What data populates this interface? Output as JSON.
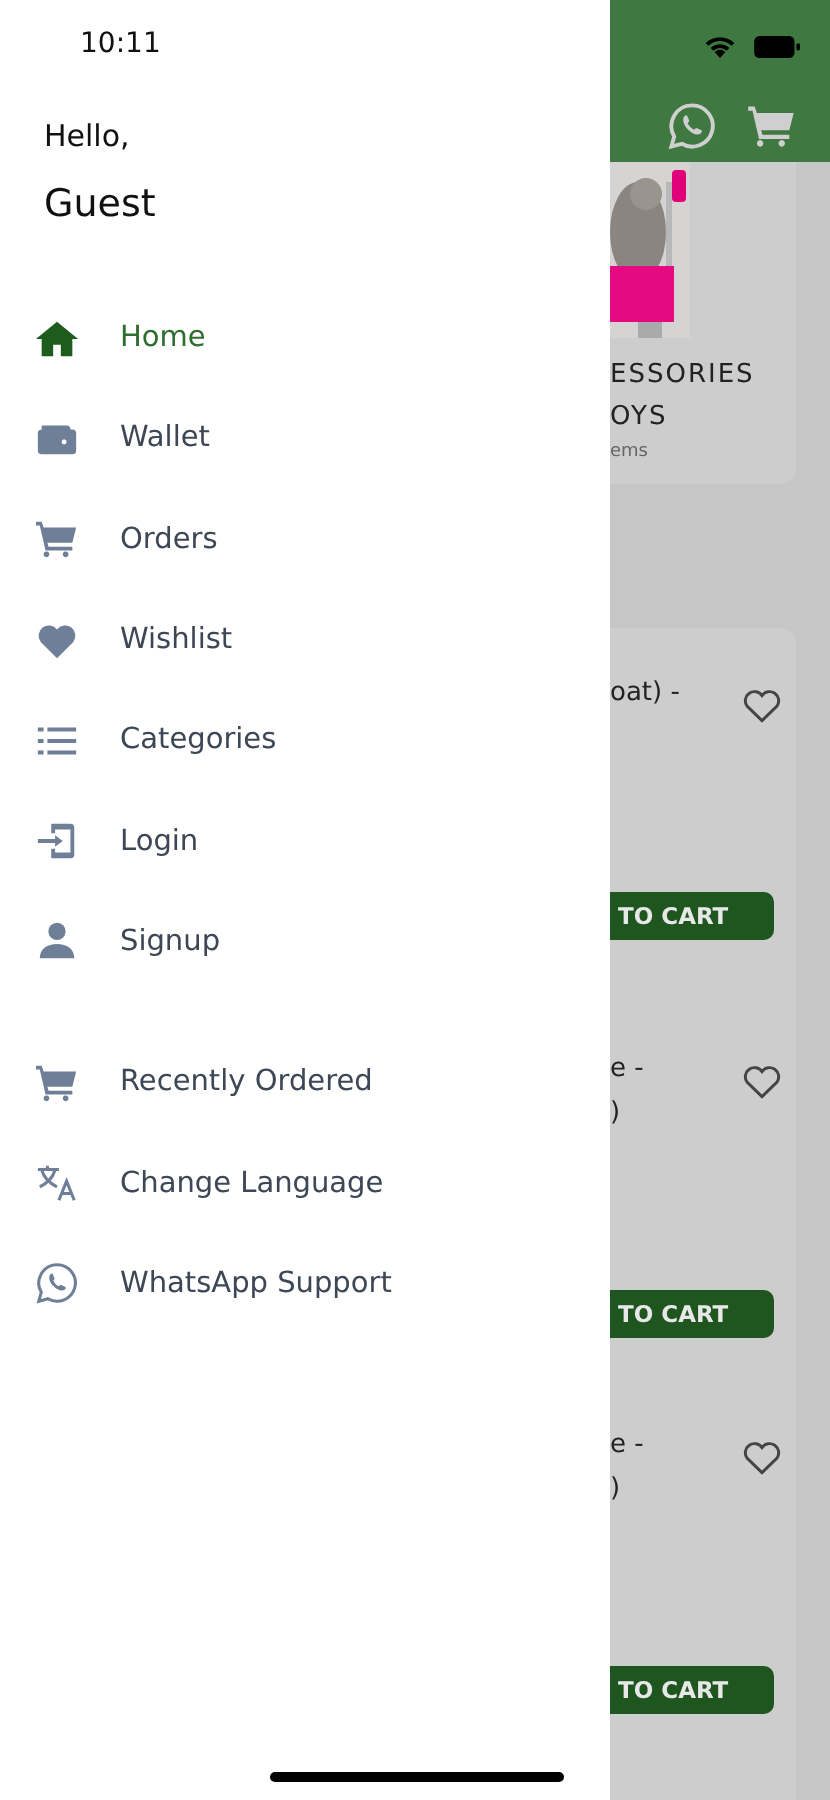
{
  "status_bar": {
    "time": "10:11"
  },
  "drawer": {
    "greeting": "Hello,",
    "name": "Guest",
    "sections": [
      {
        "items": [
          {
            "label": "Home",
            "kind": "home",
            "selected": true
          },
          {
            "label": "Wallet",
            "kind": "wallet",
            "selected": false
          },
          {
            "label": "Orders",
            "kind": "cart",
            "selected": false
          },
          {
            "label": "Wishlist",
            "kind": "heart",
            "selected": false
          },
          {
            "label": "Categories",
            "kind": "list",
            "selected": false
          },
          {
            "label": "Login",
            "kind": "login",
            "selected": false
          },
          {
            "label": "Signup",
            "kind": "person",
            "selected": false
          }
        ]
      },
      {
        "items": [
          {
            "label": "Recently Ordered",
            "kind": "cart",
            "selected": false
          },
          {
            "label": "Change Language",
            "kind": "translate",
            "selected": false
          },
          {
            "label": "WhatsApp Support",
            "kind": "whatsapp",
            "selected": false
          }
        ]
      }
    ]
  },
  "background": {
    "category_card": {
      "image": {
        "kind": "picture"
      },
      "title_lines": [
        "ESSORIES",
        "OYS"
      ],
      "subtitle": "ems"
    },
    "products": [
      {
        "title_lines": [
          "oat) -"
        ],
        "button": "TO CART"
      },
      {
        "title_lines": [
          "e -",
          ")"
        ],
        "button": "TO CART"
      },
      {
        "title_lines": [
          "e -",
          ")"
        ],
        "button": "TO CART"
      }
    ]
  }
}
